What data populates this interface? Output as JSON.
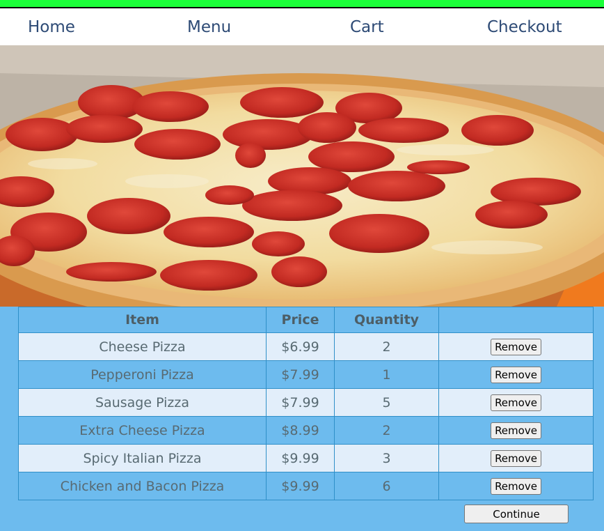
{
  "nav": {
    "items": [
      {
        "label": "Home"
      },
      {
        "label": "Menu"
      },
      {
        "label": "Cart"
      },
      {
        "label": "Checkout"
      }
    ]
  },
  "hero": {
    "image": "pepperoni-pizza-photo"
  },
  "cart": {
    "headers": {
      "item": "Item",
      "price": "Price",
      "quantity": "Quantity",
      "action": ""
    },
    "rows": [
      {
        "item": "Cheese Pizza",
        "price": "$6.99",
        "quantity": "2",
        "action": "Remove"
      },
      {
        "item": "Pepperoni Pizza",
        "price": "$7.99",
        "quantity": "1",
        "action": "Remove"
      },
      {
        "item": "Sausage Pizza",
        "price": "$7.99",
        "quantity": "5",
        "action": "Remove"
      },
      {
        "item": "Extra Cheese Pizza",
        "price": "$8.99",
        "quantity": "2",
        "action": "Remove"
      },
      {
        "item": "Spicy Italian Pizza",
        "price": "$9.99",
        "quantity": "3",
        "action": "Remove"
      },
      {
        "item": "Chicken and Bacon Pizza",
        "price": "$9.99",
        "quantity": "6",
        "action": "Remove"
      }
    ],
    "continue_label": "Continue"
  },
  "colors": {
    "top_bar": "#1cff3a",
    "page_background": "#6dbbee",
    "row_light": "#e2eefa",
    "nav_text": "#2d4a75"
  }
}
